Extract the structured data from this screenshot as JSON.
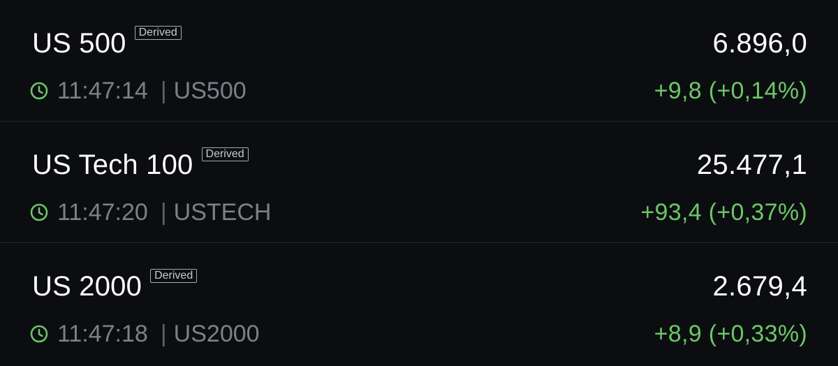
{
  "colors": {
    "background": "#0c0d11",
    "text_primary": "#ffffff",
    "text_secondary": "#7e8087",
    "positive": "#6bc766",
    "divider": "#24262c"
  },
  "instruments": [
    {
      "name": "US 500",
      "badge": "Derived",
      "price": "6.896,0",
      "time": "11:47:14",
      "separator": "|",
      "symbol": "US500",
      "change": "+9,8 (+0,14%)",
      "icon": "clock-icon"
    },
    {
      "name": "US Tech 100",
      "badge": "Derived",
      "price": "25.477,1",
      "time": "11:47:20",
      "separator": "|",
      "symbol": "USTECH",
      "change": "+93,4 (+0,37%)",
      "icon": "clock-icon"
    },
    {
      "name": "US 2000",
      "badge": "Derived",
      "price": "2.679,4",
      "time": "11:47:18",
      "separator": "|",
      "symbol": "US2000",
      "change": "+8,9 (+0,33%)",
      "icon": "clock-icon"
    }
  ]
}
